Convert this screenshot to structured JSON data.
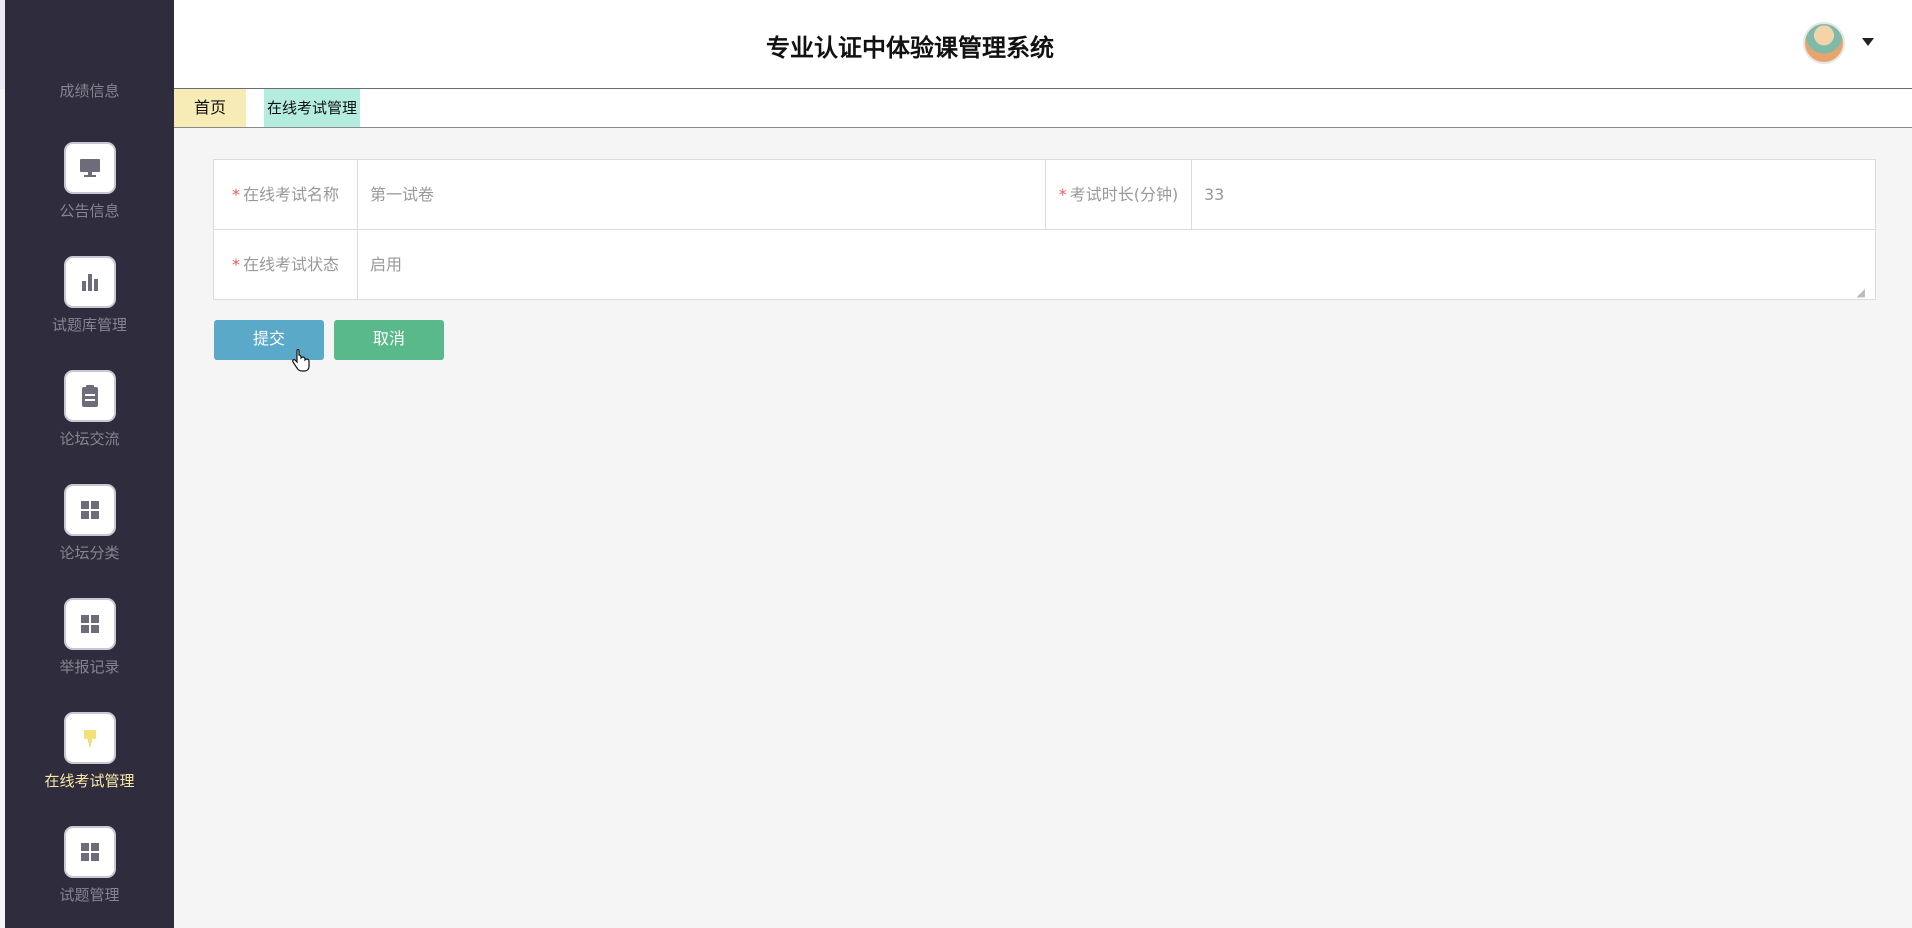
{
  "header": {
    "title": "专业认证中体验课管理系统"
  },
  "sidebar": {
    "partial_item": "成绩信息",
    "items": [
      {
        "label": "公告信息",
        "icon": "monitor-icon"
      },
      {
        "label": "试题库管理",
        "icon": "bar-chart-icon"
      },
      {
        "label": "论坛交流",
        "icon": "clipboard-icon"
      },
      {
        "label": "论坛分类",
        "icon": "grid-icon"
      },
      {
        "label": "举报记录",
        "icon": "grid-icon"
      },
      {
        "label": "在线考试管理",
        "icon": "marker-icon",
        "active": true
      },
      {
        "label": "试题管理",
        "icon": "grid-icon"
      }
    ]
  },
  "tabs": {
    "home": "首页",
    "current": "在线考试管理"
  },
  "form": {
    "name_label": "在线考试名称",
    "name_value": "第一试卷",
    "duration_label": "考试时长(分钟)",
    "duration_value": "33",
    "status_label": "在线考试状态",
    "status_value": "启用",
    "required_mark": "*"
  },
  "buttons": {
    "submit": "提交",
    "cancel": "取消"
  },
  "colors": {
    "sidebar_bg": "#2f2c3d",
    "active_label": "#f7e7a6",
    "submit": "#5aa9c8",
    "cancel": "#5ab98a"
  }
}
